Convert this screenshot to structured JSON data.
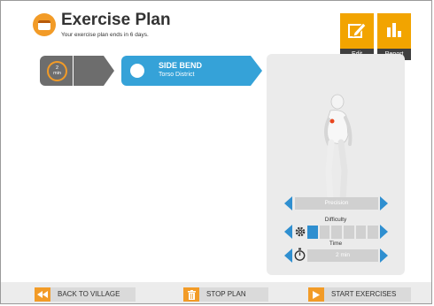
{
  "header": {
    "title": "Exercise Plan",
    "subtitle": "Your exercise plan ends in 6 days."
  },
  "top_buttons": {
    "edit_label": "Edit",
    "report_label": "Report"
  },
  "exercise_strip": {
    "timer_value": "2",
    "timer_unit": "min",
    "active_name": "SIDE BEND",
    "active_area": "Torso District"
  },
  "settings": {
    "precision_label": "Precision",
    "difficulty_label": "Difficulty",
    "difficulty_level": 1,
    "difficulty_max": 6,
    "time_label": "Time",
    "time_value": "2 min"
  },
  "bottom_bar": {
    "back_label": "BACK TO VILLAGE",
    "stop_label": "STOP PLAN",
    "start_label": "START EXERCISES"
  },
  "colors": {
    "accent_orange": "#f29b27",
    "accent_blue": "#35a2d8",
    "tile_gray": "#6d6d6d"
  }
}
